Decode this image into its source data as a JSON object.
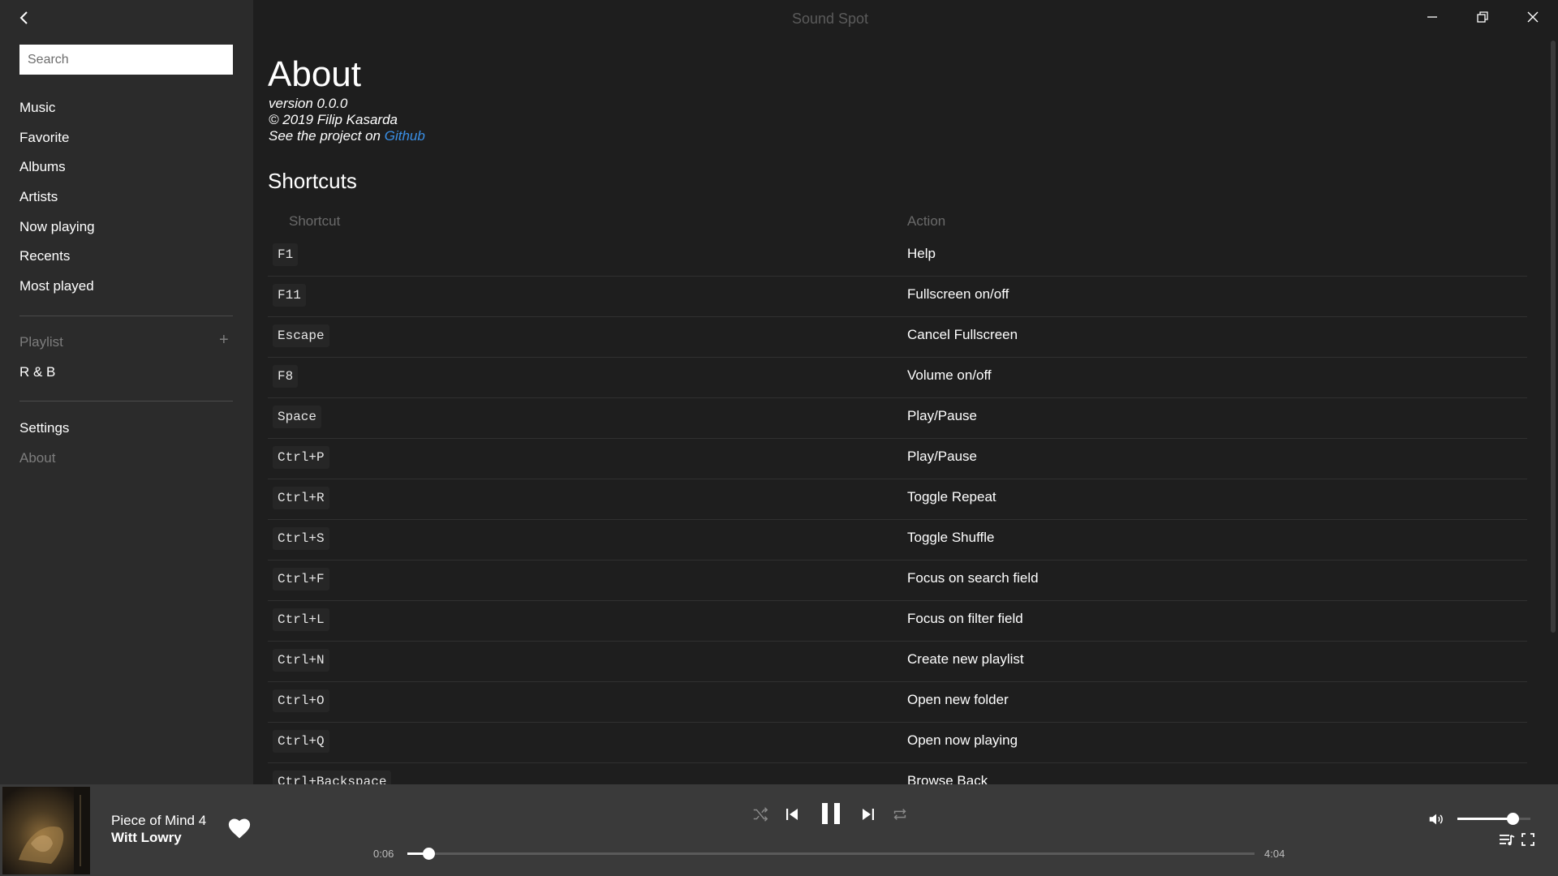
{
  "app": {
    "title": "Sound Spot"
  },
  "sidebar": {
    "search_placeholder": "Search",
    "nav": [
      "Music",
      "Favorite",
      "Albums",
      "Artists",
      "Now playing",
      "Recents",
      "Most played"
    ],
    "playlist_label": "Playlist",
    "playlist_add": "+",
    "playlists": [
      "R & B"
    ],
    "settings": "Settings",
    "about": "About"
  },
  "about": {
    "title": "About",
    "version": "version 0.0.0",
    "copyright": "© 2019 Filip Kasarda",
    "project_prefix": "See the project on ",
    "project_link": "Github"
  },
  "shortcuts": {
    "title": "Shortcuts",
    "col_shortcut": "Shortcut",
    "col_action": "Action",
    "rows": [
      {
        "key": "F1",
        "action": "Help"
      },
      {
        "key": "F11",
        "action": "Fullscreen on/off"
      },
      {
        "key": "Escape",
        "action": "Cancel Fullscreen"
      },
      {
        "key": "F8",
        "action": "Volume on/off"
      },
      {
        "key": "Space",
        "action": "Play/Pause"
      },
      {
        "key": "Ctrl+P",
        "action": "Play/Pause"
      },
      {
        "key": "Ctrl+R",
        "action": "Toggle Repeat"
      },
      {
        "key": "Ctrl+S",
        "action": "Toggle Shuffle"
      },
      {
        "key": "Ctrl+F",
        "action": "Focus on search field"
      },
      {
        "key": "Ctrl+L",
        "action": "Focus on filter field"
      },
      {
        "key": "Ctrl+N",
        "action": "Create new playlist"
      },
      {
        "key": "Ctrl+O",
        "action": "Open new folder"
      },
      {
        "key": "Ctrl+Q",
        "action": "Open now playing"
      },
      {
        "key": "Ctrl+Backspace",
        "action": "Browse Back"
      }
    ]
  },
  "player": {
    "track_title": "Piece of Mind 4",
    "track_artist": "Witt Lowry",
    "elapsed": "0:06",
    "duration": "4:04",
    "progress_fraction": 0.025,
    "volume_fraction": 0.75
  },
  "colors": {
    "background": "#1e1e1e",
    "sidebar": "#2b2b2b",
    "player_bar": "#3a3a3a",
    "link": "#3a8fe6"
  },
  "icons": {
    "back": "chevron-left-icon",
    "minimize": "minimize-icon",
    "restore": "restore-icon",
    "close": "close-icon",
    "heart": "heart-icon",
    "shuffle": "shuffle-icon",
    "previous": "skip-previous-icon",
    "pause": "pause-icon",
    "next": "skip-next-icon",
    "repeat": "repeat-icon",
    "volume": "volume-icon",
    "queue": "queue-icon",
    "fullscreen": "fullscreen-icon"
  }
}
